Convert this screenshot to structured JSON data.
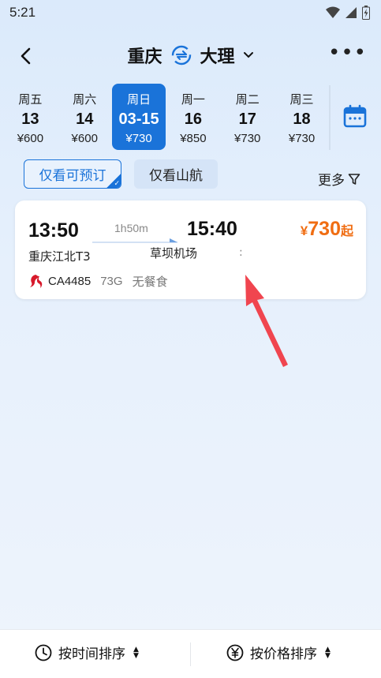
{
  "status_bar": {
    "time": "5:21"
  },
  "header": {
    "from_city": "重庆",
    "to_city": "大理",
    "more_label": "•••",
    "accent_color": "#1a73d9"
  },
  "dates": [
    {
      "dow": "周五",
      "day": "13",
      "price": "¥600",
      "active": false
    },
    {
      "dow": "周六",
      "day": "14",
      "price": "¥600",
      "active": false
    },
    {
      "dow": "周日",
      "day": "03-15",
      "price": "¥730",
      "active": true
    },
    {
      "dow": "周一",
      "day": "16",
      "price": "¥850",
      "active": false
    },
    {
      "dow": "周二",
      "day": "17",
      "price": "¥730",
      "active": false
    },
    {
      "dow": "周三",
      "day": "18",
      "price": "¥730",
      "active": false
    }
  ],
  "filters": {
    "bookable_only": "仅看可预订",
    "shandong_only": "仅看山航",
    "more": "更多"
  },
  "flight": {
    "dep_time": "13:50",
    "dep_airport": "重庆江北T3",
    "duration": "1h50m",
    "arr_time": "15:40",
    "arr_airport": "草坝机场",
    "arr_extra": ":",
    "price_currency": "¥",
    "price_amount": "730",
    "price_suffix": "起",
    "flight_no": "CA4485",
    "aircraft": "73G",
    "meal": "无餐食",
    "price_color": "#f06d12"
  },
  "sort": {
    "by_time": "按时间排序",
    "by_price": "按价格排序"
  }
}
